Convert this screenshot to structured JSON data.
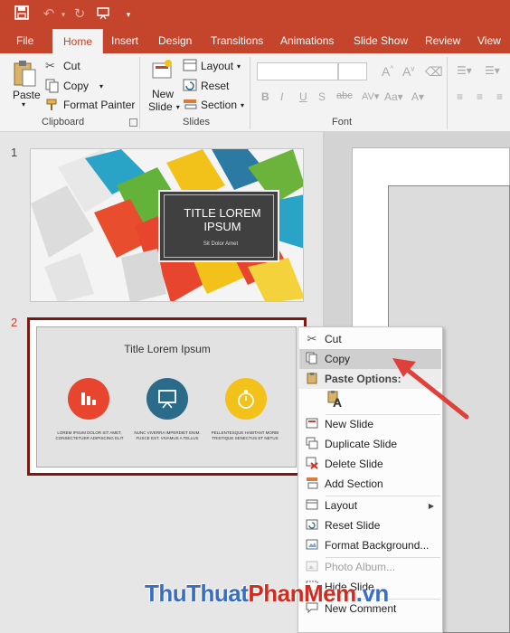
{
  "ribbon": {
    "tabs": [
      "File",
      "Home",
      "Insert",
      "Design",
      "Transitions",
      "Animations",
      "Slide Show",
      "Review",
      "View"
    ],
    "active_tab": "Home",
    "clipboard": {
      "paste": "Paste",
      "cut": "Cut",
      "copy": "Copy",
      "format_painter": "Format Painter",
      "label": "Clipboard"
    },
    "slides": {
      "new_slide_line1": "New",
      "new_slide_line2": "Slide",
      "layout": "Layout",
      "reset": "Reset",
      "section": "Section",
      "label": "Slides"
    },
    "font": {
      "label": "Font",
      "bold": "B",
      "italic": "I",
      "underline": "U",
      "strike": "S",
      "shadow": "abc"
    }
  },
  "thumbnails": [
    {
      "number": "1",
      "title": "TITLE LOREM IPSUM",
      "subtitle": "Sit Dolor Amet"
    },
    {
      "number": "2",
      "title": "Title Lorem Ipsum",
      "captions": [
        "LOREM IPSUM DOLOR SIT AMET, CONSECTETUER ADIPISCING ELIT",
        "NUNC VIVERRA IMPERDIET ENIM. FUSCE EST. VIVAMUS A TELLUS",
        "PELLENTESQUE HABITANT MORBI TRISTIQUE SENECTUS ET NETUS"
      ]
    }
  ],
  "context_menu": {
    "items": [
      {
        "label": "Cut",
        "icon": "scissors-icon",
        "state": "normal"
      },
      {
        "label": "Copy",
        "icon": "copy-icon",
        "state": "highlighted"
      },
      {
        "label": "Paste Options:",
        "icon": "clipboard-icon",
        "state": "header"
      },
      {
        "label": "New Slide",
        "icon": "new-slide-icon",
        "state": "normal"
      },
      {
        "label": "Duplicate Slide",
        "icon": "duplicate-slide-icon",
        "state": "normal"
      },
      {
        "label": "Delete Slide",
        "icon": "delete-slide-icon",
        "state": "normal"
      },
      {
        "label": "Add Section",
        "icon": "add-section-icon",
        "state": "normal"
      },
      {
        "label": "Layout",
        "icon": "layout-icon",
        "state": "submenu"
      },
      {
        "label": "Reset Slide",
        "icon": "reset-slide-icon",
        "state": "normal"
      },
      {
        "label": "Format Background...",
        "icon": "format-background-icon",
        "state": "normal"
      },
      {
        "label": "Photo Album...",
        "icon": "photo-album-icon",
        "state": "disabled"
      },
      {
        "label": "Hide Slide",
        "icon": "hide-slide-icon",
        "state": "normal"
      },
      {
        "label": "New Comment",
        "icon": "comment-icon",
        "state": "normal"
      }
    ],
    "paste_option_glyph": "A"
  },
  "watermark": {
    "part1": "ThuThuat",
    "part2": "PhanMem",
    "part3": ".vn"
  },
  "colors": {
    "accent": "#c4442c",
    "selection_border": "#7a1a12",
    "annotation_arrow": "#e0403a",
    "thumb_icon_red": "#e8452f",
    "thumb_icon_teal": "#2b6b8a",
    "thumb_icon_yellow": "#f2c21b"
  }
}
